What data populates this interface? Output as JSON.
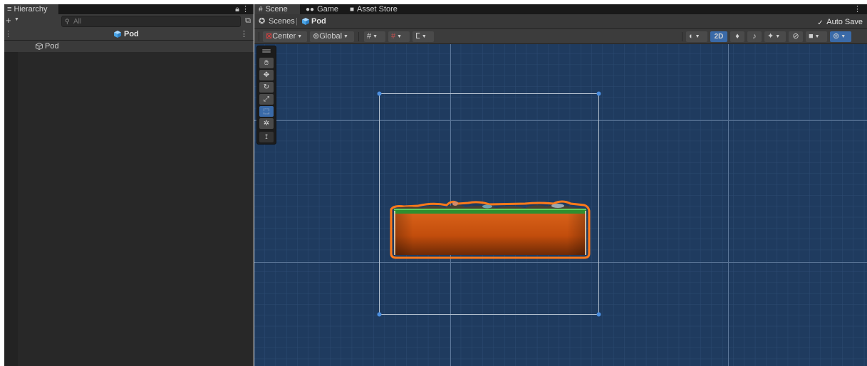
{
  "hierarchy": {
    "tab_label": "Hierarchy",
    "tab_icon": "list-icon",
    "lock_icon": "lock-icon",
    "menu_icon": "kebab-menu-icon",
    "add_label": "+",
    "search_placeholder": "All",
    "prefab_header": "Pod",
    "items": [
      {
        "label": "Pod",
        "icon": "prefab-cube-icon"
      }
    ]
  },
  "scene_tabs": [
    {
      "label": "Scene",
      "icon": "grid-icon",
      "active": true
    },
    {
      "label": "Game",
      "icon": "gamepad-icon",
      "active": false
    },
    {
      "label": "Asset Store",
      "icon": "shopping-bag-icon",
      "active": false
    }
  ],
  "breadcrumb": {
    "scenes": "Scenes",
    "separator": "|",
    "current": "Pod"
  },
  "auto_save": {
    "label": "Auto Save",
    "checked": true
  },
  "scene_toolbar": {
    "pivot": "Center",
    "space": "Global",
    "mode_2d": "2D"
  },
  "colors": {
    "viewport_bg": "#1f3b5f",
    "accent": "#3a6aa8",
    "platform_dirt": "#c9520e",
    "platform_grass": "#2f8f2f",
    "selection_outline": "#ff7a1a"
  },
  "tool_palette": [
    {
      "name": "hand-tool",
      "icon": "hand-icon"
    },
    {
      "name": "move-tool",
      "icon": "move-arrows-icon"
    },
    {
      "name": "rotate-tool",
      "icon": "rotate-icon"
    },
    {
      "name": "scale-tool",
      "icon": "scale-icon"
    },
    {
      "name": "rect-tool",
      "icon": "rect-icon",
      "active": true
    },
    {
      "name": "transform-tool",
      "icon": "transform-icon"
    },
    {
      "name": "custom-tool",
      "icon": "custom-editor-tool-icon"
    }
  ]
}
